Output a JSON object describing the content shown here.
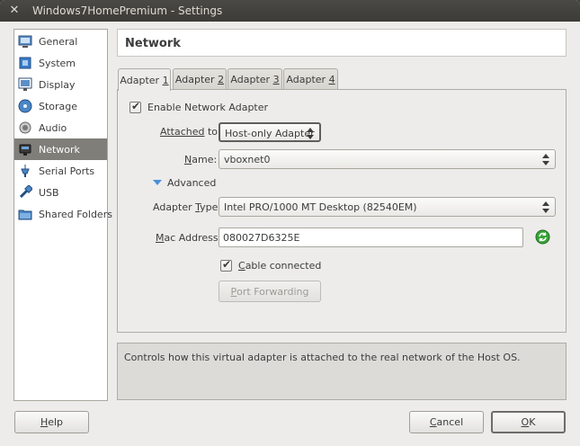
{
  "window": {
    "title": "Windows7HomePremium - Settings"
  },
  "sidebar": {
    "items": [
      {
        "label": "General",
        "icon": "general-icon"
      },
      {
        "label": "System",
        "icon": "system-icon"
      },
      {
        "label": "Display",
        "icon": "display-icon"
      },
      {
        "label": "Storage",
        "icon": "storage-icon"
      },
      {
        "label": "Audio",
        "icon": "audio-icon"
      },
      {
        "label": "Network",
        "icon": "network-icon",
        "active": true
      },
      {
        "label": "Serial Ports",
        "icon": "serial-ports-icon"
      },
      {
        "label": "USB",
        "icon": "usb-icon"
      },
      {
        "label": "Shared Folders",
        "icon": "shared-folders-icon"
      }
    ]
  },
  "header": {
    "title": "Network"
  },
  "tabs": [
    {
      "pre": "Adapter ",
      "key": "1"
    },
    {
      "pre": "Adapter ",
      "key": "2"
    },
    {
      "pre": "Adapter ",
      "key": "3"
    },
    {
      "pre": "Adapter ",
      "key": "4"
    }
  ],
  "adapter": {
    "enable_label": "Enable Network Adapter",
    "enable_checked": true,
    "attached": {
      "label_pre": "Attached",
      "label_key": " to:",
      "value": "Host-only Adapter"
    },
    "name": {
      "label_key": "N",
      "label_rest": "ame:",
      "value": "vboxnet0"
    },
    "advanced_label": "Advanced",
    "adapter_type": {
      "label_pre": "Adapter ",
      "label_key": "T",
      "label_rest": "ype:",
      "value": "Intel PRO/1000 MT Desktop (82540EM)"
    },
    "mac": {
      "label_key": "M",
      "label_rest": "ac Address:",
      "value": "080027D6325E"
    },
    "cable": {
      "label_key": "C",
      "label_rest": "able connected",
      "checked": true
    },
    "port_forwarding": {
      "label_key": "P",
      "label_rest": "ort Forwarding"
    }
  },
  "description": "Controls how this virtual adapter is attached to the real network of the Host OS.",
  "buttons": {
    "help": {
      "key": "H",
      "rest": "elp"
    },
    "cancel": {
      "key": "C",
      "rest": "ancel"
    },
    "ok": {
      "key": "O",
      "rest": "K"
    }
  },
  "colors": {
    "accent": "#4a90d9",
    "selection": "#7f7e79",
    "refresh": "#2f9e2f"
  }
}
